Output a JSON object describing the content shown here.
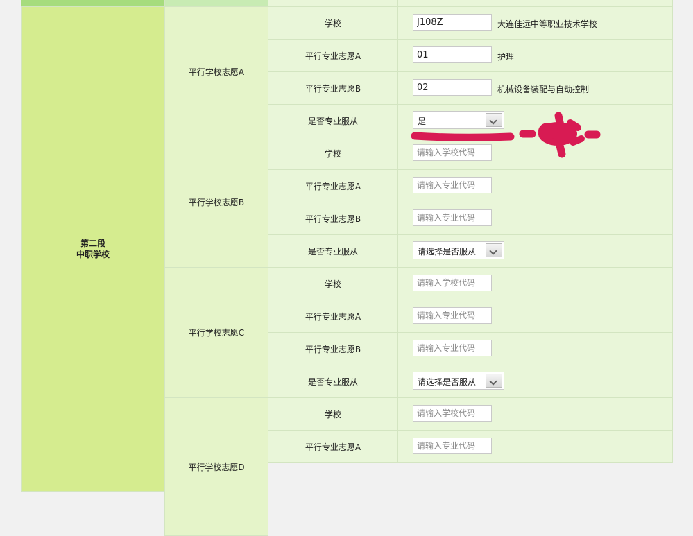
{
  "stage_label": [
    "第二段",
    "中职学校"
  ],
  "groups": [
    {
      "title": "平行学校志愿A",
      "rows": [
        {
          "label": "学校",
          "kind": "input",
          "value": "J108Z",
          "placeholder": "请输入学校代码",
          "desc": "大连佳远中等职业技术学校"
        },
        {
          "label": "平行专业志愿A",
          "kind": "input",
          "value": "01",
          "placeholder": "请输入专业代码",
          "desc": "护理"
        },
        {
          "label": "平行专业志愿B",
          "kind": "input",
          "value": "02",
          "placeholder": "请输入专业代码",
          "desc": "机械设备装配与自动控制"
        },
        {
          "label": "是否专业服从",
          "kind": "select",
          "value": "是"
        }
      ]
    },
    {
      "title": "平行学校志愿B",
      "rows": [
        {
          "label": "学校",
          "kind": "input",
          "value": "",
          "placeholder": "请输入学校代码",
          "desc": ""
        },
        {
          "label": "平行专业志愿A",
          "kind": "input",
          "value": "",
          "placeholder": "请输入专业代码",
          "desc": ""
        },
        {
          "label": "平行专业志愿B",
          "kind": "input",
          "value": "",
          "placeholder": "请输入专业代码",
          "desc": ""
        },
        {
          "label": "是否专业服从",
          "kind": "select",
          "value": "请选择是否服从"
        }
      ]
    },
    {
      "title": "平行学校志愿C",
      "rows": [
        {
          "label": "学校",
          "kind": "input",
          "value": "",
          "placeholder": "请输入学校代码",
          "desc": ""
        },
        {
          "label": "平行专业志愿A",
          "kind": "input",
          "value": "",
          "placeholder": "请输入专业代码",
          "desc": ""
        },
        {
          "label": "平行专业志愿B",
          "kind": "input",
          "value": "",
          "placeholder": "请输入专业代码",
          "desc": ""
        },
        {
          "label": "是否专业服从",
          "kind": "select",
          "value": "请选择是否服从"
        }
      ]
    },
    {
      "title": "平行学校志愿D",
      "rows": [
        {
          "label": "学校",
          "kind": "input",
          "value": "",
          "placeholder": "请输入学校代码",
          "desc": ""
        },
        {
          "label": "平行专业志愿A",
          "kind": "input",
          "value": "",
          "placeholder": "请输入专业代码",
          "desc": ""
        }
      ]
    }
  ],
  "colors": {
    "stage_bg": "#d5ec8f",
    "group_bg": "#e5f4c9",
    "row_bg": "#e9f6d9",
    "annotation": "#d81b53"
  }
}
